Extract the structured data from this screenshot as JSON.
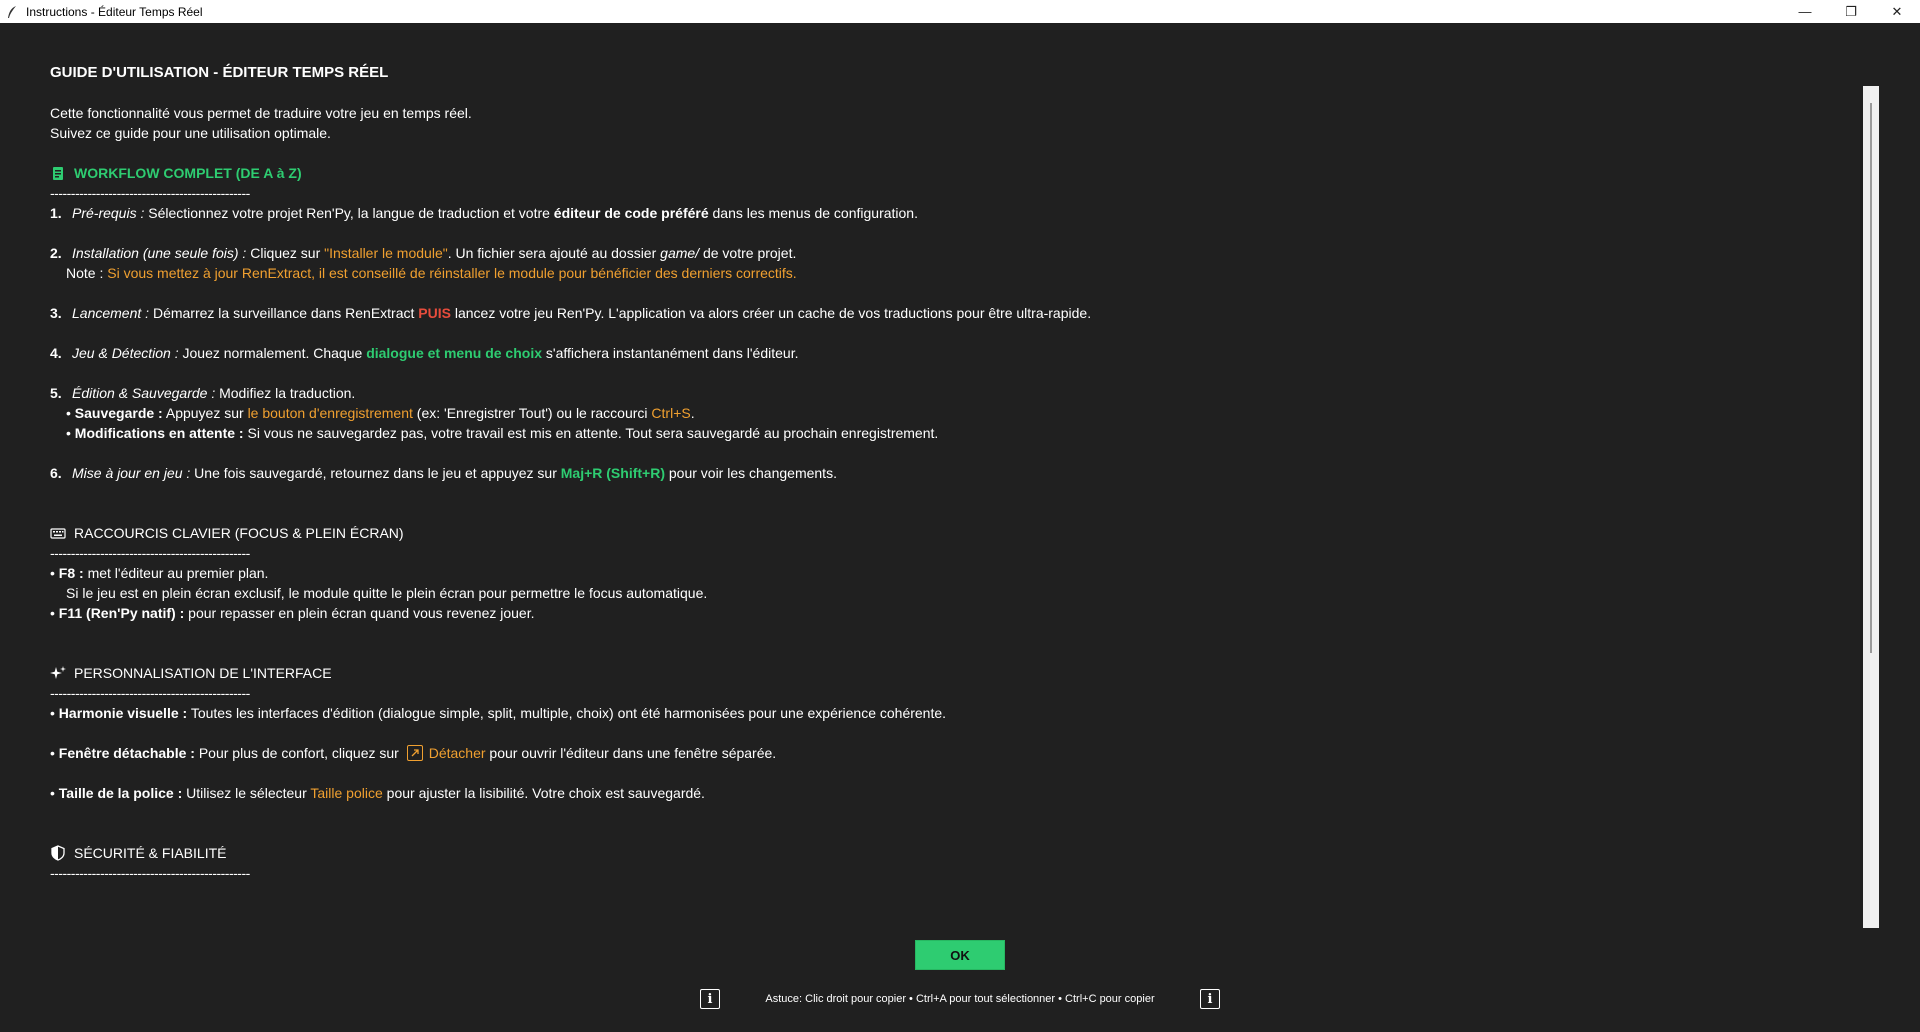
{
  "window": {
    "title": "Instructions - Éditeur Temps Réel",
    "minimize": "—",
    "maximize": "❐",
    "close": "✕"
  },
  "doc": {
    "heading": "GUIDE D'UTILISATION - ÉDITEUR TEMPS RÉEL",
    "intro": [
      "Cette fonctionnalité vous permet de traduire votre jeu en temps réel.",
      "Suivez ce guide pour une utilisation optimale."
    ],
    "separator": "------------------------------------------------",
    "workflow": {
      "title": "WORKFLOW COMPLET (DE A à Z)",
      "steps": [
        {
          "num": "1.",
          "label": "Pré-requis :",
          "t1": " Sélectionnez votre projet Ren'Py, la langue de traduction et votre ",
          "bold": "éditeur de code préféré",
          "t2": " dans les menus de configuration."
        },
        {
          "num": "2.",
          "label": "Installation (une seule fois) :",
          "t1": " Cliquez sur ",
          "hl": "\"Installer le module\"",
          "t2": ". Un fichier sera ajouté au dossier ",
          "it": "game/",
          "t3": " de votre projet.",
          "note_label": "Note : ",
          "note_text": "Si vous mettez à jour RenExtract, il est conseillé de réinstaller le module pour bénéficier des derniers correctifs."
        },
        {
          "num": "3.",
          "label": "Lancement :",
          "t1": " Démarrez la surveillance dans RenExtract ",
          "hl": "PUIS",
          "t2": " lancez votre jeu Ren'Py. L'application va alors créer un cache de vos traductions pour être ultra-rapide."
        },
        {
          "num": "4.",
          "label": "Jeu & Détection :",
          "t1": " Jouez normalement. Chaque ",
          "hl": "dialogue et menu de choix",
          "t2": " s'affichera instantanément dans l'éditeur."
        },
        {
          "num": "5.",
          "label": "Édition & Sauvegarde :",
          "t1": " Modifiez la traduction.",
          "save_label": "Sauvegarde :",
          "save_t1": " Appuyez sur ",
          "save_hl": "le bouton d'enregistrement",
          "save_t2": " (ex: 'Enregistrer Tout') ou le raccourci ",
          "save_key": "Ctrl+S",
          "save_t3": ".",
          "pending_label": "Modifications en attente :",
          "pending_text": " Si vous ne sauvegardez pas, votre travail est mis en attente. Tout sera sauvegardé au prochain enregistrement."
        },
        {
          "num": "6.",
          "label": "Mise à jour en jeu :",
          "t1": " Une fois sauvegardé, retournez dans le jeu et appuyez sur ",
          "hl": "Maj+R (Shift+R)",
          "t2": " pour voir les changements."
        }
      ]
    },
    "shortcuts": {
      "title": "RACCOURCIS CLAVIER (FOCUS & PLEIN ÉCRAN)",
      "f8_label": "F8 :",
      "f8_text": " met l'éditeur au premier plan.",
      "f8_note": "Si le jeu est en plein écran exclusif, le module quitte le plein écran pour permettre le focus automatique.",
      "f11_label": "F11 (Ren'Py natif) :",
      "f11_text": " pour repasser en plein écran quand vous revenez jouer."
    },
    "custom": {
      "title": "PERSONNALISATION DE L'INTERFACE",
      "harmony_label": "Harmonie visuelle :",
      "harmony_text": " Toutes les interfaces d'édition (dialogue simple, split, multiple, choix) ont été harmonisées pour une expérience cohérente.",
      "detach_label": "Fenêtre détachable :",
      "detach_t1": " Pour plus de confort, cliquez sur ",
      "detach_hl": "Détacher",
      "detach_t2": " pour ouvrir l'éditeur dans une fenêtre séparée.",
      "font_label": "Taille de la police :",
      "font_t1": " Utilisez le sélecteur ",
      "font_hl": "Taille police",
      "font_t2": " pour ajuster la lisibilité. Votre choix est sauvegardé."
    },
    "security": {
      "title": "SÉCURITÉ & FIABILITÉ"
    }
  },
  "ok_button": "OK",
  "tip": "Astuce: Clic droit pour copier • Ctrl+A pour tout sélectionner • Ctrl+C pour copier",
  "info_icon_glyph": "i",
  "colors": {
    "background": "#202020",
    "accent_green": "#2ecc71",
    "highlight_orange": "#f0a030",
    "highlight_red": "#e74c3c"
  }
}
